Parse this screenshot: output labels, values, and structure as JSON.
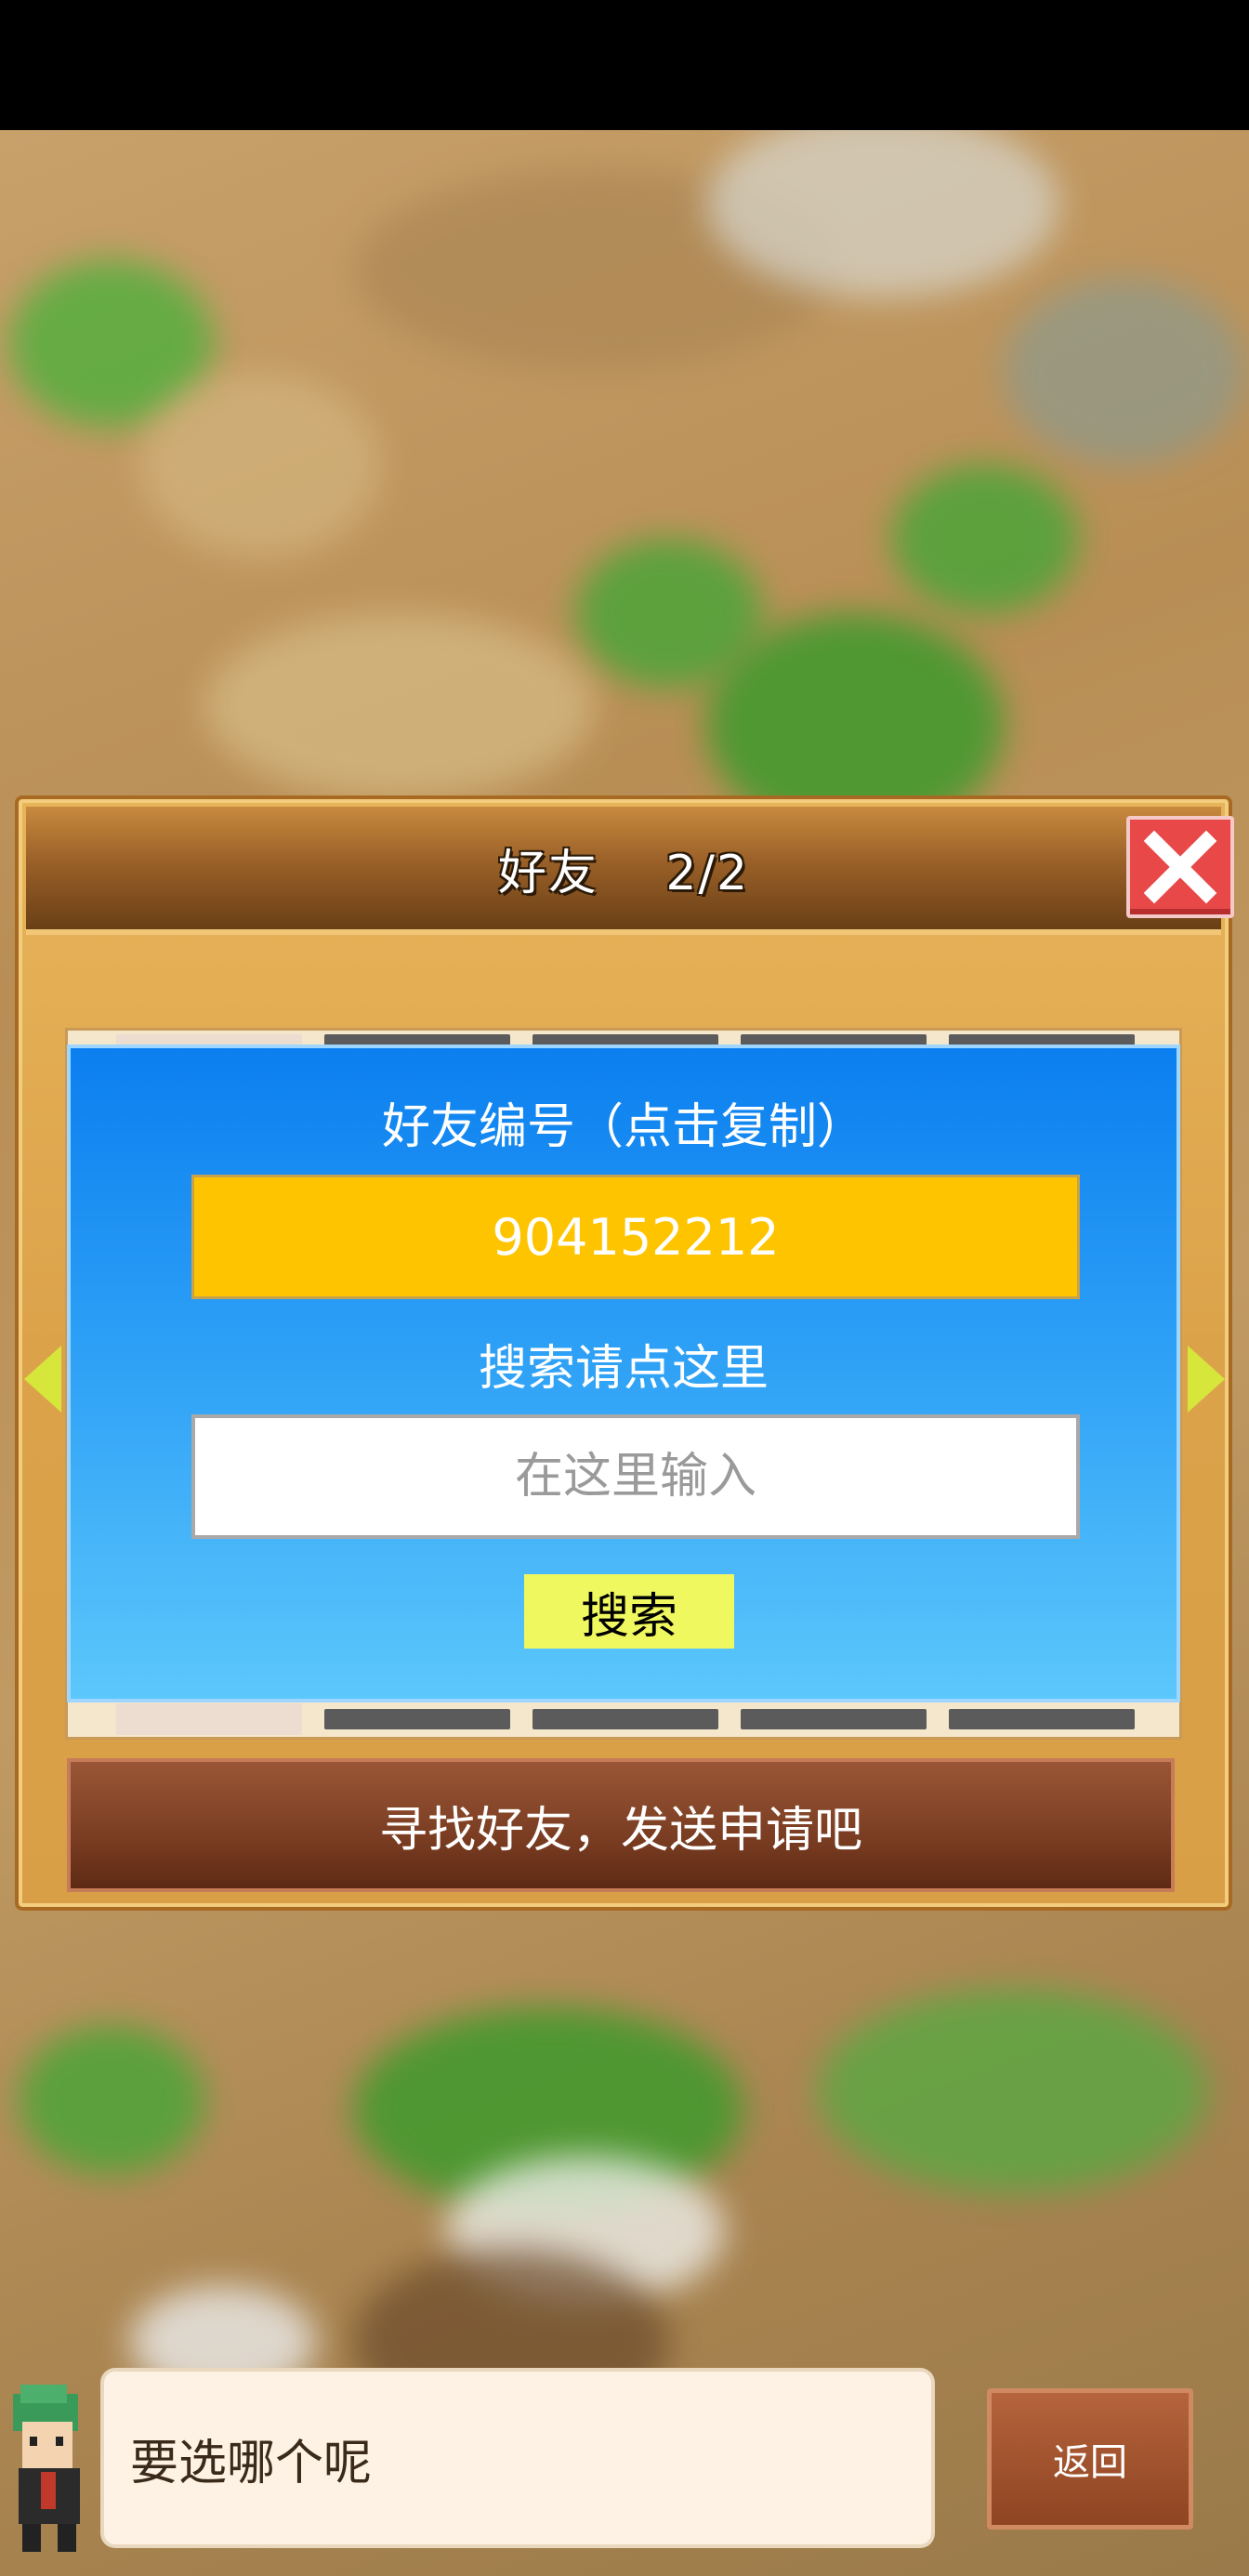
{
  "dialog": {
    "title": "好友　 2/2",
    "close_icon": "close-x-icon"
  },
  "friend_panel": {
    "id_label": "好友编号（点击复制）",
    "friend_id": "904152212",
    "search_label": "搜索请点这里",
    "search_placeholder": "在这里输入",
    "search_button": "搜索"
  },
  "find_friends_button": "寻找好友，发送申请吧",
  "bottom": {
    "speech": "要选哪个呢",
    "back_button": "返回"
  },
  "colors": {
    "panel_blue": "#0b7fef",
    "id_yellow": "#ffc400",
    "search_button": "#f0f860",
    "close_red": "#e84848"
  }
}
